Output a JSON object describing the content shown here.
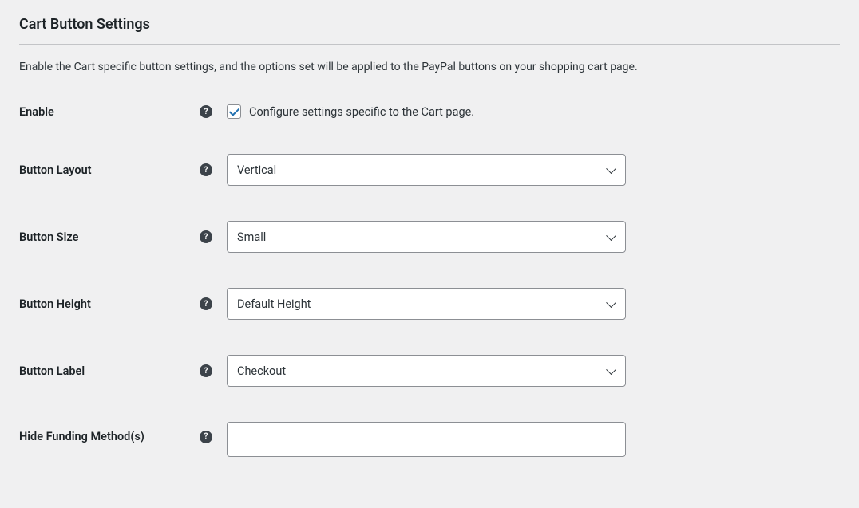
{
  "section": {
    "title": "Cart Button Settings",
    "description": "Enable the Cart specific button settings, and the options set will be applied to the PayPal buttons on your shopping cart page."
  },
  "fields": {
    "enable": {
      "label": "Enable",
      "checkbox_label": "Configure settings specific to the Cart page.",
      "checked": true
    },
    "button_layout": {
      "label": "Button Layout",
      "value": "Vertical"
    },
    "button_size": {
      "label": "Button Size",
      "value": "Small"
    },
    "button_height": {
      "label": "Button Height",
      "value": "Default Height"
    },
    "button_label": {
      "label": "Button Label",
      "value": "Checkout"
    },
    "hide_funding": {
      "label": "Hide Funding Method(s)",
      "value": ""
    }
  }
}
